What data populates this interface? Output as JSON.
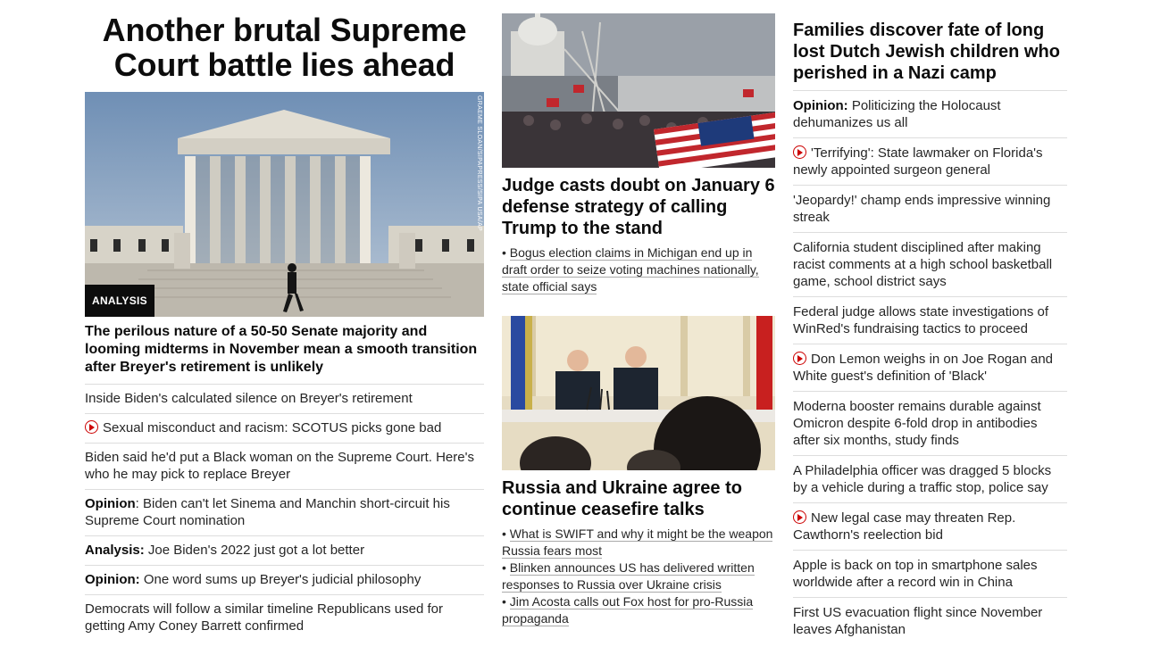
{
  "lead": {
    "headline": "Another brutal Supreme Court battle lies ahead",
    "badge": "ANALYSIS",
    "photo_credit": "GRAEME SLOAN/SIPAPRESS/SIPA USA/AP",
    "summary": "The perilous nature of a 50-50 Senate majority and looming midterms in November mean a smooth transition after Breyer's retirement is unlikely",
    "items": [
      {
        "prefix": "",
        "text": "Inside Biden's calculated silence on Breyer's retirement",
        "video": false
      },
      {
        "prefix": "",
        "text": "Sexual misconduct and racism: SCOTUS picks gone bad",
        "video": true
      },
      {
        "prefix": "",
        "text": "Biden said he'd put a Black woman on the Supreme Court. Here's who he may pick to replace Breyer",
        "video": false
      },
      {
        "prefix": "Opinion",
        "text": ": Biden can't let Sinema and Manchin short-circuit his Supreme Court nomination",
        "video": false
      },
      {
        "prefix": "Analysis:",
        "text": " Joe Biden's 2022 just got a lot better",
        "video": false
      },
      {
        "prefix": "Opinion:",
        "text": " One word sums up Breyer's judicial philosophy",
        "video": false
      },
      {
        "prefix": "",
        "text": "Democrats will follow a similar timeline Republicans used for getting Amy Coney Barrett confirmed",
        "video": false
      }
    ]
  },
  "middle": {
    "story1": {
      "headline": "Judge casts doubt on January 6 defense strategy of calling Trump to the stand",
      "bullets": [
        "Bogus election claims in Michigan end up in draft order to seize voting machines nationally, state official says"
      ]
    },
    "story2": {
      "headline": "Russia and Ukraine agree to continue ceasefire talks",
      "bullets": [
        "What is SWIFT and why it might be the weapon Russia fears most",
        "Blinken announces US has delivered written responses to Russia over Ukraine crisis",
        "Jim Acosta calls out Fox host for pro-Russia propaganda"
      ]
    }
  },
  "right": {
    "headline": "Families discover fate of long lost Dutch Jewish children who perished in a Nazi camp",
    "items": [
      {
        "prefix": "Opinion:",
        "text": " Politicizing the Holocaust dehumanizes us all",
        "video": false
      },
      {
        "prefix": "",
        "text": "'Terrifying': State lawmaker on Florida's newly appointed surgeon general",
        "video": true
      },
      {
        "prefix": "",
        "text": "'Jeopardy!' champ ends impressive winning streak",
        "video": false
      },
      {
        "prefix": "",
        "text": "California student disciplined after making racist comments at a high school basketball game, school district says",
        "video": false
      },
      {
        "prefix": "",
        "text": "Federal judge allows state investigations of WinRed's fundraising tactics to proceed",
        "video": false
      },
      {
        "prefix": "",
        "text": "Don Lemon weighs in on Joe Rogan and White guest's definition of 'Black'",
        "video": true
      },
      {
        "prefix": "",
        "text": "Moderna booster remains durable against Omicron despite 6-fold drop in antibodies after six months, study finds",
        "video": false
      },
      {
        "prefix": "",
        "text": "A Philadelphia officer was dragged 5 blocks by a vehicle during a traffic stop, police say",
        "video": false
      },
      {
        "prefix": "",
        "text": "New legal case may threaten Rep. Cawthorn's reelection bid",
        "video": true
      },
      {
        "prefix": "",
        "text": "Apple is back on top in smartphone sales worldwide after a record win in China",
        "video": false
      },
      {
        "prefix": "",
        "text": "First US evacuation flight since November leaves Afghanistan",
        "video": false
      }
    ]
  }
}
